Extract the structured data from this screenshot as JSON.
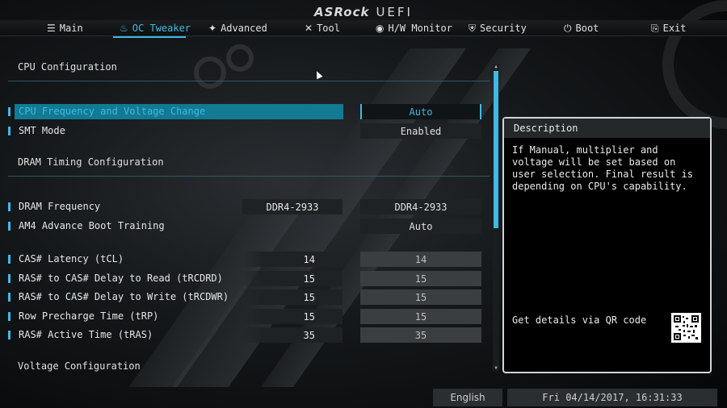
{
  "brand": {
    "name": "ASRock",
    "suffix": "UEFI"
  },
  "tabs": [
    {
      "label": "Main",
      "icon": "list-icon",
      "glyph": "☰"
    },
    {
      "label": "OC Tweaker",
      "icon": "flame-icon",
      "glyph": "♨"
    },
    {
      "label": "Advanced",
      "icon": "star-icon",
      "glyph": "✦"
    },
    {
      "label": "Tool",
      "icon": "tools-icon",
      "glyph": "✕"
    },
    {
      "label": "H/W Monitor",
      "icon": "monitor-icon",
      "glyph": "◉"
    },
    {
      "label": "Security",
      "icon": "shield-icon",
      "glyph": "⛨"
    },
    {
      "label": "Boot",
      "icon": "power-icon",
      "glyph": "⏻"
    },
    {
      "label": "Exit",
      "icon": "exit-icon",
      "glyph": "⎘"
    }
  ],
  "active_tab": "OC Tweaker",
  "sections": {
    "cpu": "CPU Configuration",
    "dram": "DRAM Timing Configuration",
    "voltage": "Voltage Configuration"
  },
  "items": {
    "cpu_freq": {
      "label": "CPU Frequency and Voltage Change",
      "value": "Auto"
    },
    "smt": {
      "label": "SMT Mode",
      "value": "Enabled"
    },
    "dram_freq": {
      "label": "DRAM Frequency",
      "current": "DDR4-2933",
      "value": "DDR4-2933"
    },
    "am4_boot": {
      "label": "AM4 Advance Boot Training",
      "value": "Auto"
    },
    "tcl": {
      "label": "CAS# Latency (tCL)",
      "current": "14",
      "value": "14"
    },
    "trcdrd": {
      "label": "RAS# to CAS# Delay to Read  (tRCDRD)",
      "current": "15",
      "value": "15"
    },
    "trcdwr": {
      "label": "RAS# to CAS# Delay to Write (tRCDWR)",
      "current": "15",
      "value": "15"
    },
    "trp": {
      "label": "Row Precharge Time (tRP)",
      "current": "15",
      "value": "15"
    },
    "tras": {
      "label": "RAS# Active Time (tRAS)",
      "current": "35",
      "value": "35"
    }
  },
  "description": {
    "title": "Description",
    "text": "If Manual, multiplier and voltage will be set based on user selection. Final result is depending on CPU's capability.",
    "qr_label": "Get details via QR code"
  },
  "footer": {
    "language": "English",
    "datetime": "Fri 04/14/2017, 16:31:33"
  },
  "colors": {
    "accent": "#3fb9e6",
    "selection": "#127a92"
  }
}
